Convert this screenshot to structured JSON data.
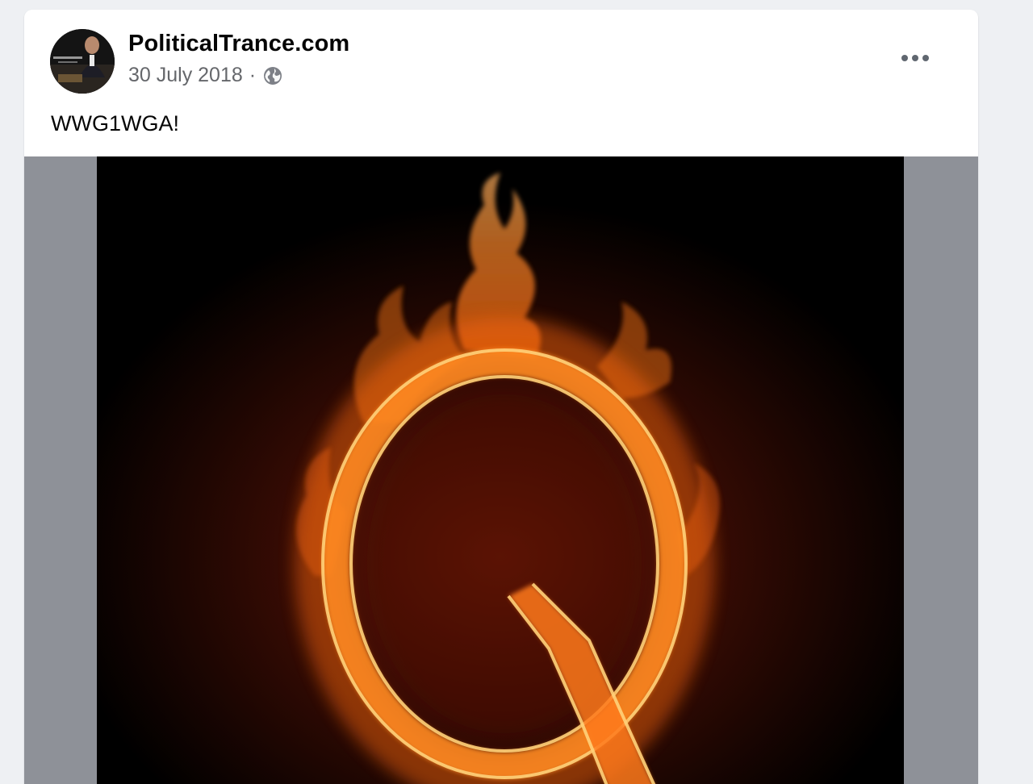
{
  "post": {
    "author": "PoliticalTrance.com",
    "date": "30 July 2018",
    "separator": "·",
    "audience_icon": "globe-icon",
    "more_icon": "more-options-icon",
    "text": "WWG1WGA!",
    "image_description_icon": "flaming-q-letter-image"
  },
  "colors": {
    "page_bg": "#eef0f3",
    "card_bg": "#ffffff",
    "name_text": "#050505",
    "meta_text": "#65676b",
    "media_letterbox": "#8e9198",
    "image_bg": "#000000",
    "flame_core": "#ffd27a",
    "flame_outer": "#ff7a1a"
  }
}
